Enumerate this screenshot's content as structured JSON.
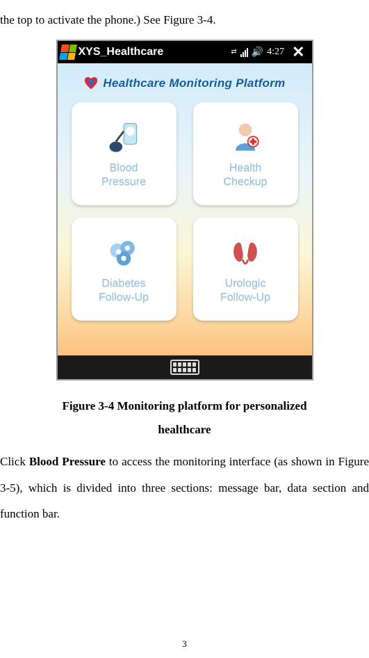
{
  "doc": {
    "topLine": "the top to activate the phone.) See Figure 3-4.",
    "caption_line1": "Figure 3-4 Monitoring platform for personalized",
    "caption_line2": "healthcare",
    "para2_a": "Click ",
    "para2_bold": "Blood Pressure",
    "para2_b": " to access the monitoring interface (as shown in Figure 3-5), which is divided into three sections: message bar, data section and function bar.",
    "pageNumber": "3"
  },
  "phone": {
    "appTitle": "XYS_Healthcare",
    "time": "4:27",
    "banner": "Healthcare Monitoring Platform",
    "tiles": [
      {
        "label_l1": "Blood",
        "label_l2": "Pressure"
      },
      {
        "label_l1": "Health",
        "label_l2": "Checkup"
      },
      {
        "label_l1": "Diabetes",
        "label_l2": "Follow-Up"
      },
      {
        "label_l1": "Urologic",
        "label_l2": "Follow-Up"
      }
    ]
  }
}
